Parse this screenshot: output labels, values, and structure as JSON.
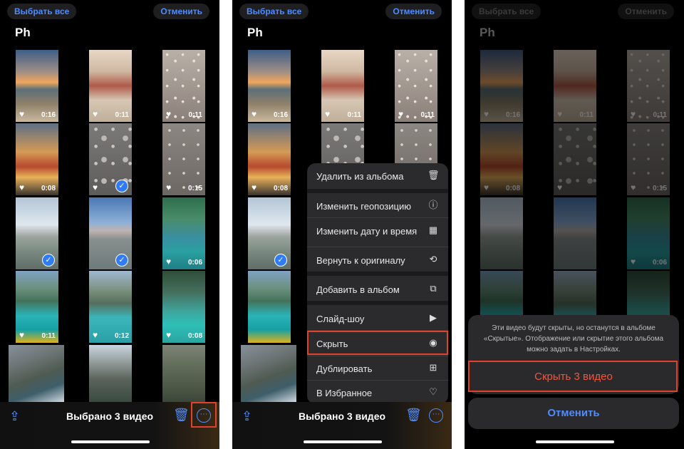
{
  "header": {
    "select_all": "Выбрать все",
    "cancel": "Отменить",
    "title": "Ph"
  },
  "toolbar": {
    "selected_label": "Выбрано 3 видео"
  },
  "grid": [
    {
      "heart": "♥",
      "duration": "0:16",
      "checked": false
    },
    {
      "heart": "♥",
      "duration": "0:11",
      "checked": false
    },
    {
      "heart": "♥",
      "duration": "0:11",
      "checked": false
    },
    {
      "heart": "♥",
      "duration": "0:08",
      "checked": false
    },
    {
      "heart": "♥",
      "duration": "",
      "checked": true
    },
    {
      "heart": "♥",
      "duration": "0:15",
      "checked": false
    },
    {
      "heart": "",
      "duration": "",
      "checked": true
    },
    {
      "heart": "",
      "duration": "",
      "checked": true
    },
    {
      "heart": "♥",
      "duration": "0:06",
      "checked": false
    },
    {
      "heart": "♥",
      "duration": "0:11",
      "checked": false
    },
    {
      "heart": "♥",
      "duration": "0:12",
      "checked": false
    },
    {
      "heart": "♥",
      "duration": "0:08",
      "checked": false
    }
  ],
  "menu": {
    "items": [
      {
        "label": "Удалить из альбома",
        "icon": "trash-icon"
      },
      {
        "label": "Изменить геопозицию",
        "icon": "location-info-icon"
      },
      {
        "label": "Изменить дату и время",
        "icon": "calendar-icon"
      },
      {
        "label": "Вернуть к оригиналу",
        "icon": "revert-icon"
      },
      {
        "label": "Добавить в альбом",
        "icon": "add-album-icon"
      },
      {
        "label": "Слайд-шоу",
        "icon": "play-icon"
      },
      {
        "label": "Скрыть",
        "icon": "eye-slash-icon"
      },
      {
        "label": "Дублировать",
        "icon": "duplicate-icon"
      },
      {
        "label": "В Избранное",
        "icon": "heart-icon"
      }
    ]
  },
  "sheet": {
    "message": "Эти видео будут скрыты, но останутся в альбоме «Скрытые». Отображение или скрытие этого альбома можно задать в Настройках.",
    "hide_button": "Скрыть 3 видео",
    "cancel_button": "Отменить"
  },
  "colors": {
    "accent": "#4f8cff",
    "highlight": "#e2412c",
    "destructive": "#f0563e"
  }
}
